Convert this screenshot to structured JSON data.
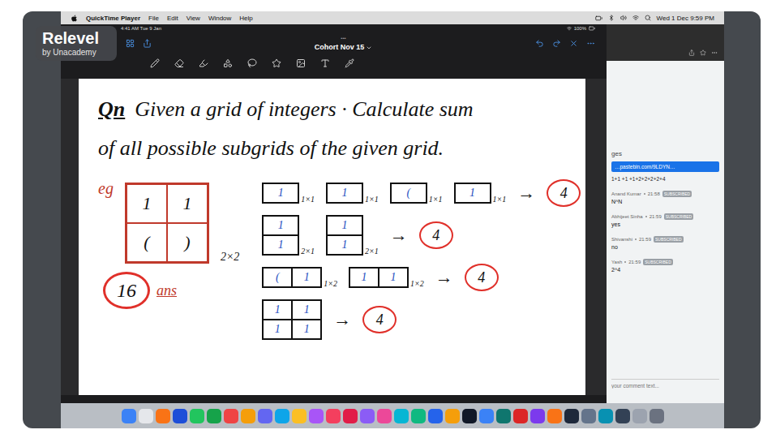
{
  "menu_bar": {
    "app": "QuickTime Player",
    "items": [
      "File",
      "Edit",
      "View",
      "Window",
      "Help"
    ],
    "clock": "Wed 1 Dec 9:59 PM"
  },
  "watermark": {
    "title": "Relevel",
    "subtitle": "by Unacademy"
  },
  "tablet": {
    "time": "4:41 AM  Tue 9 Jan",
    "battery": "100%",
    "dots": "•••",
    "title": "Cohort Nov 15"
  },
  "note": {
    "question_mark": "Qn",
    "lines": [
      "Given a grid of integers · Calculate sum",
      "of all possible subgrids of the given grid."
    ],
    "example": {
      "label": "eg",
      "cells": [
        "1",
        "1",
        "(",
        ")"
      ],
      "size": "2×2",
      "answer": "16",
      "answer_label": "ans"
    },
    "arrow": "→",
    "groups": [
      {
        "result": "4",
        "items": [
          {
            "size": "1×1",
            "rows": 1,
            "cols": 1,
            "cells": [
              "1"
            ]
          },
          {
            "size": "1×1",
            "rows": 1,
            "cols": 1,
            "cells": [
              "1"
            ]
          },
          {
            "size": "1×1",
            "rows": 1,
            "cols": 1,
            "cells": [
              "("
            ]
          },
          {
            "size": "1×1",
            "rows": 1,
            "cols": 1,
            "cells": [
              "1"
            ]
          }
        ]
      },
      {
        "result": "4",
        "items": [
          {
            "size": "2×1",
            "rows": 2,
            "cols": 1,
            "cells": [
              "1",
              "1"
            ]
          },
          {
            "size": "2×1",
            "rows": 2,
            "cols": 1,
            "cells": [
              "1",
              "1"
            ]
          }
        ]
      },
      {
        "result": "4",
        "items": [
          {
            "size": "1×2",
            "rows": 1,
            "cols": 2,
            "cells": [
              "(",
              "1"
            ]
          },
          {
            "size": "1×2",
            "rows": 1,
            "cols": 2,
            "cells": [
              "1",
              "1"
            ]
          }
        ]
      },
      {
        "result": "4",
        "items": [
          {
            "size": "",
            "rows": 2,
            "cols": 2,
            "cells": [
              "1",
              "1",
              "1",
              "1"
            ]
          }
        ]
      }
    ]
  },
  "chat": {
    "header": "ges",
    "link": "…pastebin.com/9LDYN…",
    "sum": "1+1 +1 +1+2+2+2+2+4",
    "comments": [
      {
        "author": "Anand Kumar",
        "time": "21:58",
        "badge": "SUBSCRIBED",
        "text": "N^N"
      },
      {
        "author": "Abhijeet Sinha",
        "time": "21:59",
        "badge": "SUBSCRIBED",
        "text": "yes"
      },
      {
        "author": "Shivanshi",
        "time": "21:59",
        "badge": "SUBSCRIBED",
        "text": "no"
      },
      {
        "author": "Yash",
        "time": "21:59",
        "badge": "SUBSCRIBED",
        "text": "2^4"
      }
    ],
    "input_placeholder": "your comment text..."
  }
}
